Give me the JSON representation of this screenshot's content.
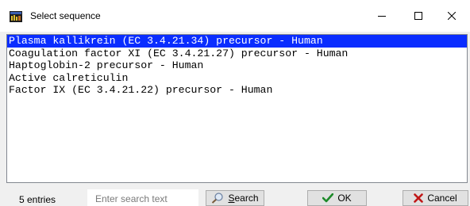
{
  "window": {
    "title": "Select sequence",
    "icon": "app-sequence-icon",
    "controls": {
      "minimize": "minimize-icon",
      "maximize": "maximize-icon",
      "close": "close-icon"
    }
  },
  "list": {
    "items": [
      "Plasma kallikrein (EC 3.4.21.34) precursor - Human",
      "Coagulation factor XI (EC 3.4.21.27) precursor - Human",
      "Haptoglobin-2 precursor - Human",
      "Active calreticulin",
      "Factor IX (EC 3.4.21.22) precursor - Human"
    ],
    "selected_index": 0
  },
  "footer": {
    "entries_label": "5 entries",
    "search_placeholder": "Enter search text",
    "search_value": "",
    "search_button": "Search",
    "ok_button": "OK",
    "cancel_button": "Cancel"
  },
  "colors": {
    "selection": "#0a2dff",
    "ok_check": "#1e8a2a",
    "cancel_x": "#c01818"
  }
}
